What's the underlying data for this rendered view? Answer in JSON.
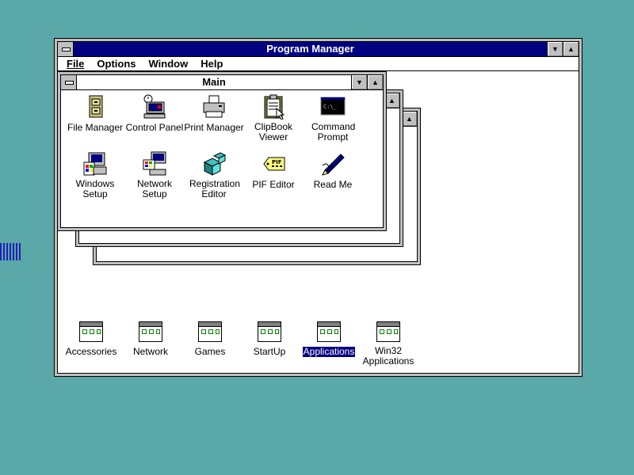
{
  "program_manager": {
    "title": "Program Manager",
    "menu": [
      "File",
      "Options",
      "Window",
      "Help"
    ]
  },
  "main_group": {
    "title": "Main",
    "icons": [
      {
        "label": "File Manager",
        "icon": "file-cabinet-icon"
      },
      {
        "label": "Control Panel",
        "icon": "control-panel-icon"
      },
      {
        "label": "Print Manager",
        "icon": "printer-icon"
      },
      {
        "label": "ClipBook Viewer",
        "icon": "clipbook-icon"
      },
      {
        "label": "Command Prompt",
        "icon": "command-prompt-icon"
      },
      {
        "label": "Windows Setup",
        "icon": "windows-setup-icon"
      },
      {
        "label": "Network Setup",
        "icon": "network-setup-icon"
      },
      {
        "label": "Registration Editor",
        "icon": "registry-editor-icon"
      },
      {
        "label": "PIF Editor",
        "icon": "pif-editor-icon"
      },
      {
        "label": "Read Me",
        "icon": "read-me-icon"
      }
    ],
    "command_prompt_text": "C:\\_",
    "pif_tag_text": "PIF"
  },
  "groups": [
    {
      "label": "Accessories",
      "selected": false
    },
    {
      "label": "Network",
      "selected": false
    },
    {
      "label": "Games",
      "selected": false
    },
    {
      "label": "StartUp",
      "selected": false
    },
    {
      "label": "Applications",
      "selected": true
    },
    {
      "label": "Win32 Applications",
      "selected": false
    }
  ],
  "colors": {
    "desktop": "#5aa8a8",
    "active_title": "#000080",
    "window_frame": "#c0c0c0"
  }
}
